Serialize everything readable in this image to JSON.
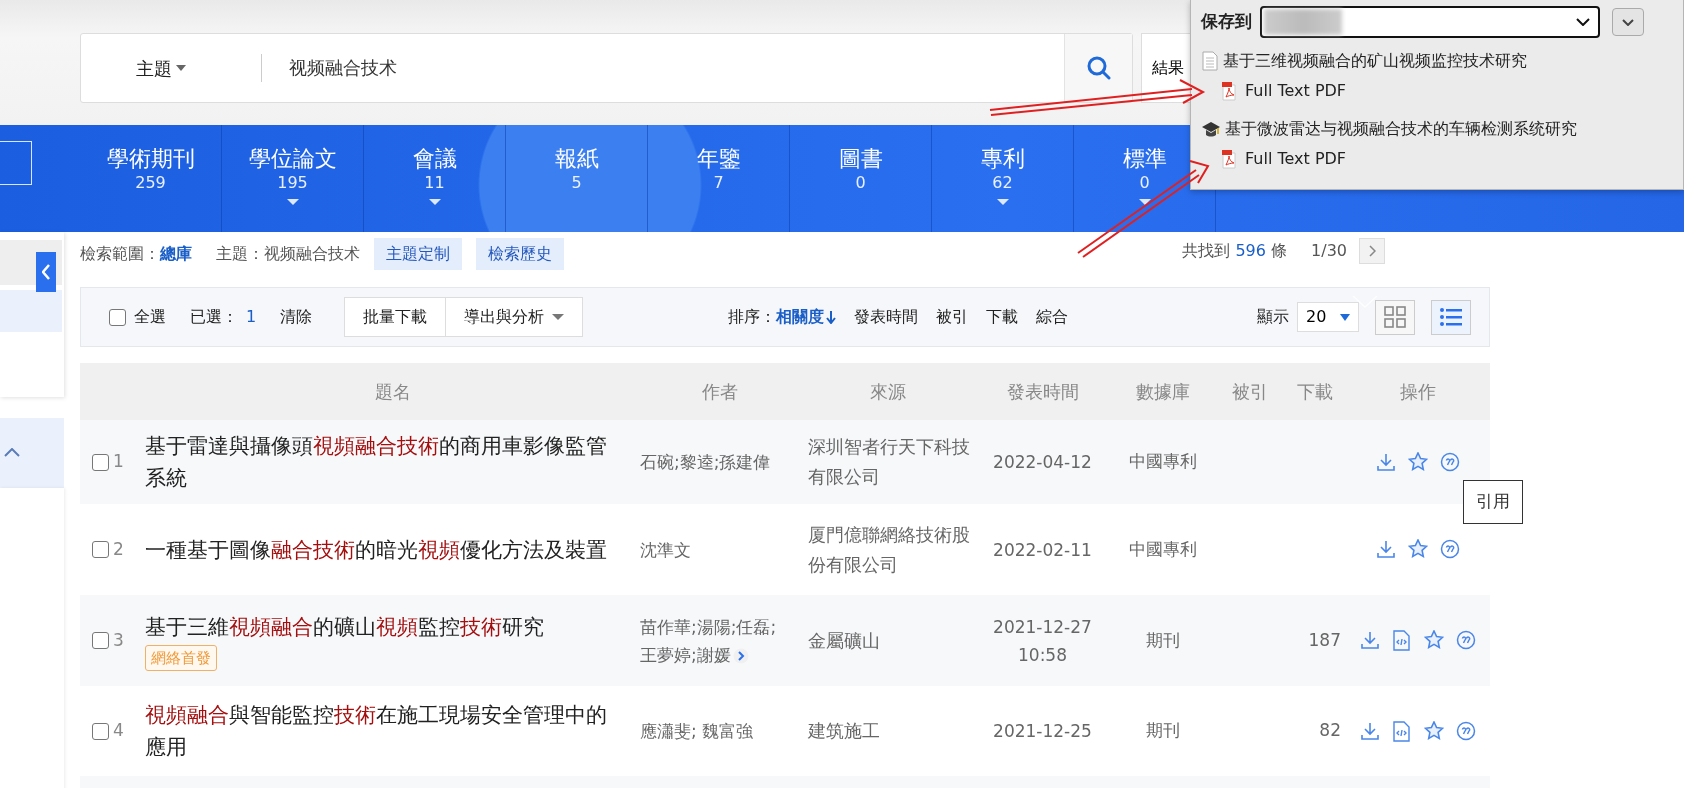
{
  "search": {
    "field_type": "主題",
    "query": "视频融合技术",
    "results_button": "結果"
  },
  "categories": [
    {
      "label": "學術期刊",
      "count": "259",
      "expandable": false
    },
    {
      "label": "學位論文",
      "count": "195",
      "expandable": true
    },
    {
      "label": "會議",
      "count": "11",
      "expandable": true
    },
    {
      "label": "報紙",
      "count": "5",
      "expandable": false
    },
    {
      "label": "年鑒",
      "count": "7",
      "expandable": false
    },
    {
      "label": "圖書",
      "count": "0",
      "expandable": false
    },
    {
      "label": "專利",
      "count": "62",
      "expandable": true
    },
    {
      "label": "標準",
      "count": "0",
      "expandable": true
    }
  ],
  "save_popup": {
    "label": "保存到",
    "items": [
      {
        "kind": "document",
        "title": "基于三维视频融合的矿山视频监控技术研究",
        "attachment": "Full Text PDF"
      },
      {
        "kind": "thesis",
        "title": "基于微波雷达与视频融合技术的车辆检测系统研究",
        "attachment": "Full Text PDF"
      }
    ]
  },
  "scope": {
    "label": "檢索範圍：",
    "value": "總庫",
    "topic": "主題：视频融合技术",
    "buttons": [
      "主題定制",
      "檢索歷史"
    ],
    "found_prefix": "共找到",
    "found_count": "596",
    "found_suffix": "條",
    "page": "1/30"
  },
  "toolbar": {
    "select_all": {
      "label": "全選",
      "checked": false
    },
    "selected_label": "已選：",
    "selected_count": "1",
    "clear": "清除",
    "buttons": [
      {
        "label": "批量下載",
        "dropdown": false
      },
      {
        "label": "導出與分析",
        "dropdown": true
      }
    ],
    "sort_label": "排序：",
    "sort_options": [
      {
        "label": "相關度",
        "selected": true
      },
      {
        "label": "發表時間",
        "selected": false
      },
      {
        "label": "被引",
        "selected": false
      },
      {
        "label": "下載",
        "selected": false
      },
      {
        "label": "綜合",
        "selected": false
      }
    ],
    "display_label": "顯示",
    "page_size": "20",
    "views": [
      {
        "kind": "grid",
        "selected": false
      },
      {
        "kind": "list",
        "selected": true
      }
    ]
  },
  "table": {
    "columns": [
      "題名",
      "作者",
      "來源",
      "發表時間",
      "數據庫",
      "被引",
      "下載",
      "操作"
    ],
    "rows": [
      {
        "number": "1",
        "checked": false,
        "title": [
          {
            "text": "基于雷達與攝像頭",
            "highlight": false
          },
          {
            "text": "視頻融合技術",
            "highlight": true
          },
          {
            "text": "的商用車影像監管系統",
            "highlight": false
          }
        ],
        "authors": "石碗;黎逵;孫建偉",
        "more_authors": false,
        "source": "深圳智者行天下科技有限公司",
        "date": "2022-04-12",
        "database": "中國專利",
        "html_reader": false
      },
      {
        "number": "2",
        "checked": false,
        "title": [
          {
            "text": "一種基于圖像",
            "highlight": false
          },
          {
            "text": "融合技術",
            "highlight": true
          },
          {
            "text": "的暗光",
            "highlight": false
          },
          {
            "text": "視頻",
            "highlight": true
          },
          {
            "text": "優化方法及裝置",
            "highlight": false
          }
        ],
        "authors": "沈準文",
        "more_authors": false,
        "source": "厦門億聯網絡技術股份有限公司",
        "date": "2022-02-11",
        "database": "中國專利",
        "html_reader": false
      },
      {
        "number": "3",
        "checked": false,
        "title": [
          {
            "text": "基于三維",
            "highlight": false
          },
          {
            "text": "視頻融合",
            "highlight": true
          },
          {
            "text": "的礦山",
            "highlight": false
          },
          {
            "text": "視頻",
            "highlight": true
          },
          {
            "text": "監控",
            "highlight": false
          },
          {
            "text": "技術",
            "highlight": true
          },
          {
            "text": "研究",
            "highlight": false
          }
        ],
        "badge": "網絡首發",
        "authors": "苗作華;湯陽;任磊;王夢婷;謝媛",
        "more_authors": true,
        "source": "金屬礦山",
        "date": "2021-12-27 10:58",
        "database": "期刊",
        "downloads": "187",
        "html_reader": true
      },
      {
        "number": "4",
        "checked": false,
        "title": [
          {
            "text": "視頻融合",
            "highlight": true
          },
          {
            "text": "與智能監控",
            "highlight": false
          },
          {
            "text": "技術",
            "highlight": true
          },
          {
            "text": "在施工現場安全管理中的應用",
            "highlight": false
          }
        ],
        "authors": "應瀟斐; 魏富強",
        "more_authors": false,
        "source": "建筑施工",
        "date": "2021-12-25",
        "database": "期刊",
        "downloads": "82",
        "html_reader": true
      }
    ]
  },
  "tooltip": "引用"
}
